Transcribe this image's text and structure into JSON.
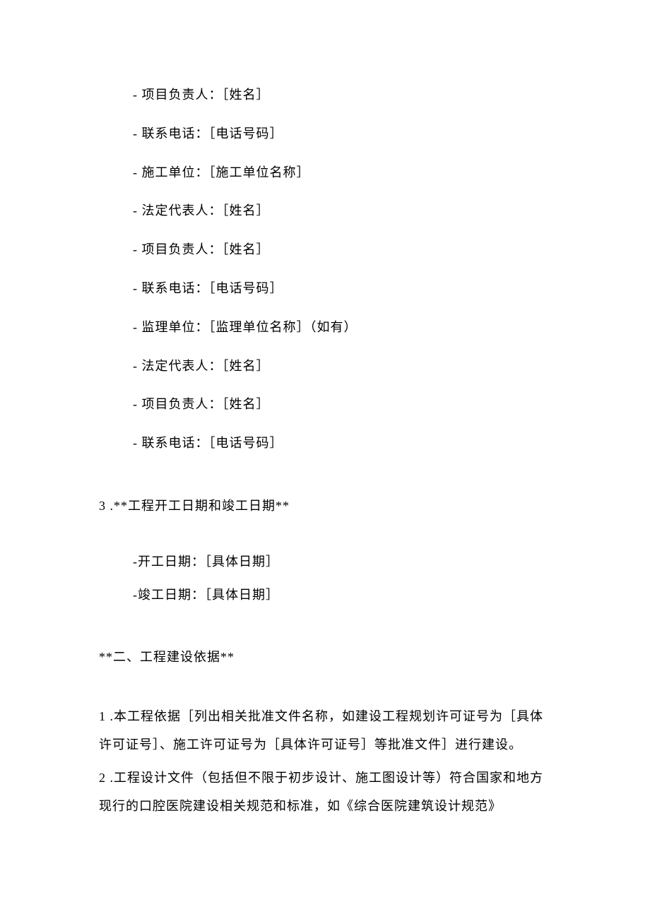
{
  "items": [
    "- 项目负责人：［姓名］",
    "- 联系电话：［电话号码］",
    "- 施工单位：［施工单位名称］",
    "- 法定代表人：［姓名］",
    "- 项目负责人：［姓名］",
    "- 联系电话：［电话号码］",
    "- 监理单位：［监理单位名称］（如有）",
    "- 法定代表人：［姓名］",
    "- 项目负责人：［姓名］",
    "- 联系电话：［电话号码］"
  ],
  "section3": {
    "header": "3 .**工程开工日期和竣工日期**",
    "subitems": [
      "-开工日期：［具体日期］",
      "-竣工日期：［具体日期］"
    ]
  },
  "section2_title": "**二、工程建设依据**",
  "paragraphs": [
    "1 .本工程依据［列出相关批准文件名称，如建设工程规划许可证号为［具体许可证号］、施工许可证号为［具体许可证号］等批准文件］进行建设。",
    "2 .工程设计文件（包括但不限于初步设计、施工图设计等）符合国家和地方现行的口腔医院建设相关规范和标准，如《综合医院建筑设计规范》"
  ]
}
